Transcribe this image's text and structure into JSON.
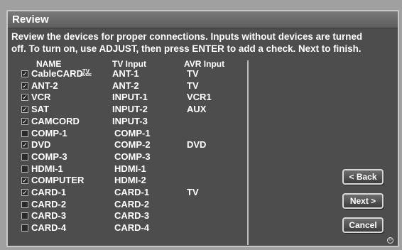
{
  "window": {
    "title": "Review",
    "instructions_line1": "Review the devices for proper connections. Inputs without devices are turned",
    "instructions_line2": "off. To turn on, use ADJUST, then press ENTER to add a check.  Next to finish."
  },
  "columns": {
    "name": "NAME",
    "tv_input": "TV Input",
    "avr_input": "AVR Input"
  },
  "devices": [
    {
      "name": "CableCARD",
      "tv_input": "ANT-1",
      "avr_input": "TV",
      "checked": true,
      "badge": "TV GUIDE"
    },
    {
      "name": "ANT-2",
      "tv_input": "ANT-2",
      "avr_input": "TV",
      "checked": true
    },
    {
      "name": "VCR",
      "tv_input": "INPUT-1",
      "avr_input": "VCR1",
      "checked": true
    },
    {
      "name": "SAT",
      "tv_input": "INPUT-2",
      "avr_input": "AUX",
      "checked": true
    },
    {
      "name": "CAMCORD",
      "tv_input": "INPUT-3",
      "avr_input": "",
      "checked": true
    },
    {
      "name": "COMP-1",
      "tv_input": "COMP-1",
      "avr_input": "",
      "checked": false
    },
    {
      "name": "DVD",
      "tv_input": "COMP-2",
      "avr_input": "DVD",
      "checked": true
    },
    {
      "name": "COMP-3",
      "tv_input": "COMP-3",
      "avr_input": "",
      "checked": false
    },
    {
      "name": "HDMI-1",
      "tv_input": "HDMI-1",
      "avr_input": "",
      "checked": false
    },
    {
      "name": "COMPUTER",
      "tv_input": "HDMI-2",
      "avr_input": "",
      "checked": true
    },
    {
      "name": "CARD-1",
      "tv_input": "CARD-1",
      "avr_input": "TV",
      "checked": true
    },
    {
      "name": "CARD-2",
      "tv_input": "CARD-2",
      "avr_input": "",
      "checked": false
    },
    {
      "name": "CARD-3",
      "tv_input": "CARD-3",
      "avr_input": "",
      "checked": false
    },
    {
      "name": "CARD-4",
      "tv_input": "CARD-4",
      "avr_input": "",
      "checked": false
    }
  ],
  "buttons": {
    "back": "< Back",
    "next": "Next >",
    "cancel": "Cancel"
  },
  "icons": {
    "checkbox_checked": "check-icon",
    "badge": "tv-guide-icon"
  },
  "colors": {
    "panel": "#4d4d4d",
    "text": "#ffffff",
    "border": "#c8c8c8"
  }
}
